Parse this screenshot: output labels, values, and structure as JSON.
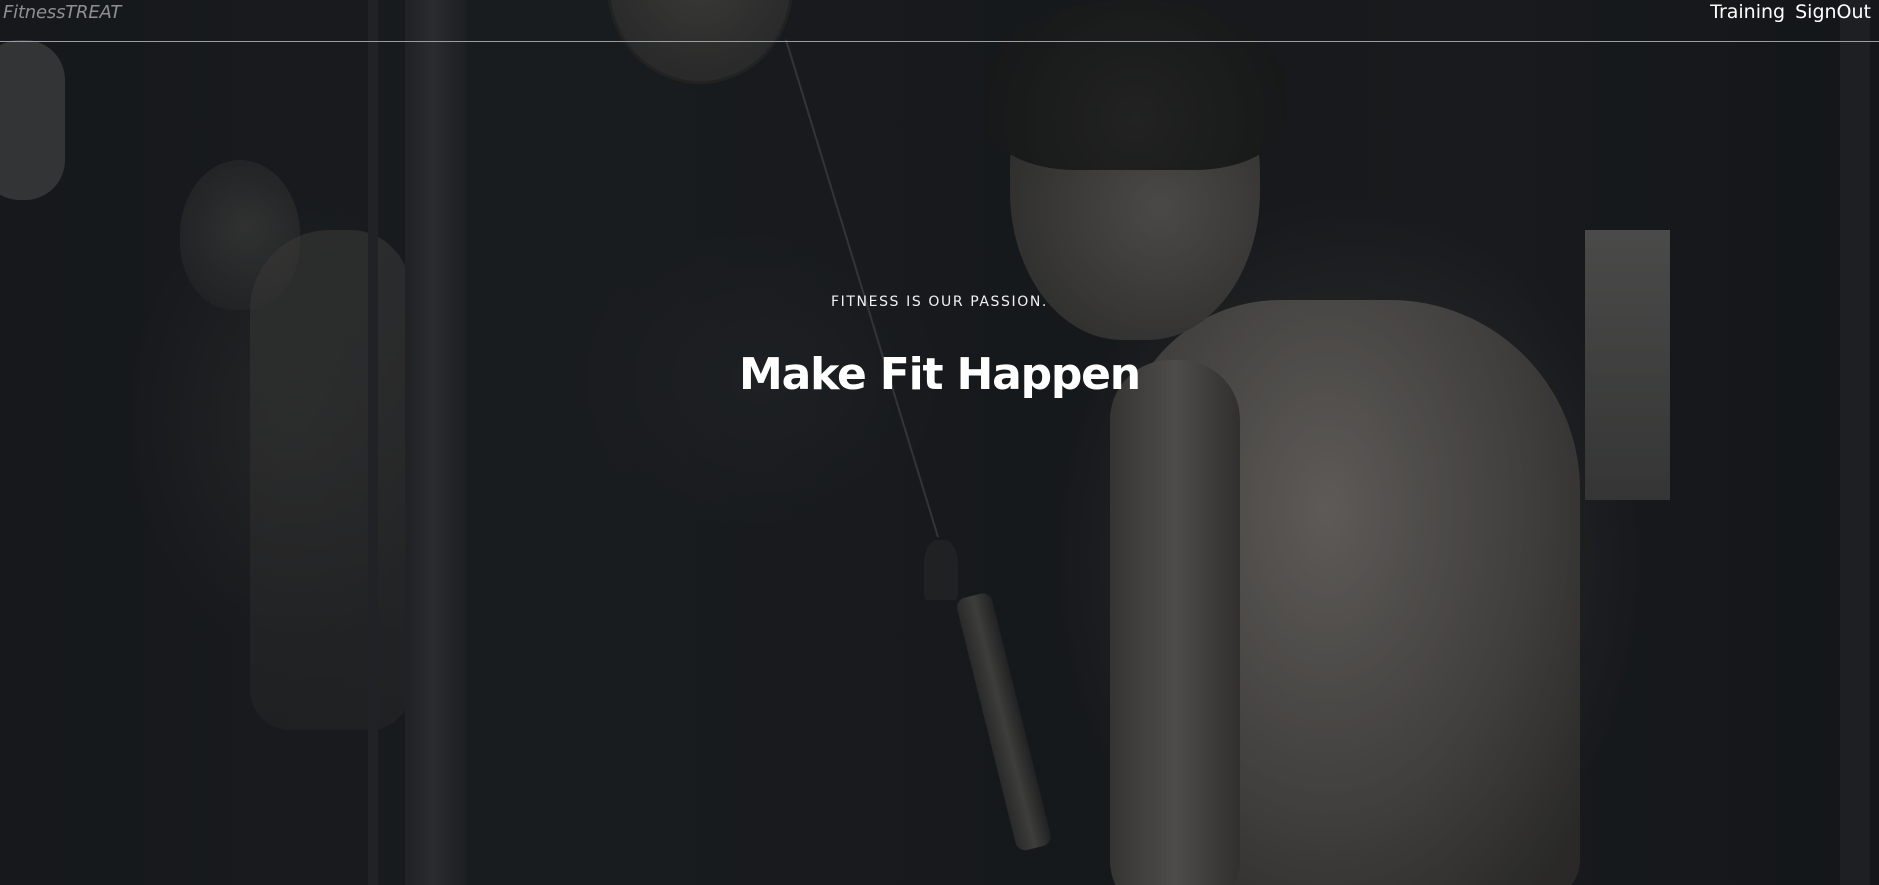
{
  "navbar": {
    "brand": "FitnessTREAT",
    "links": [
      {
        "label": "Training"
      },
      {
        "label": "SignOut"
      }
    ]
  },
  "hero": {
    "tagline": "FITNESS IS OUR PASSION.",
    "headline": "Make Fit Happen",
    "background_image": "gym-athlete-photo"
  },
  "colors": {
    "overlay": "#101215",
    "text": "#ffffff",
    "brand": "#8d8f93",
    "divider": "#9a9da2"
  }
}
